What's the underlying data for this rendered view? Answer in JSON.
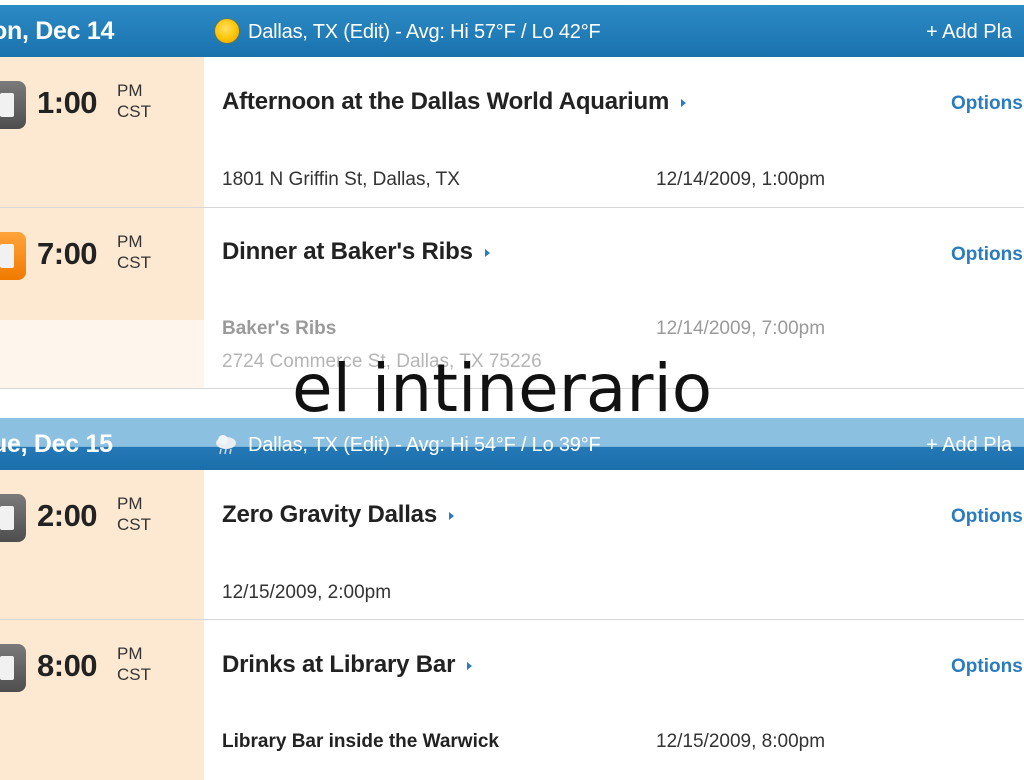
{
  "overlay": {
    "title": "el intinerario"
  },
  "days": [
    {
      "title": "on, Dec 14",
      "weather_icon": "sun-icon",
      "weather": "Dallas, TX (Edit) - Avg: Hi 57°F / Lo 42°F",
      "add_place": "+ Add Pla",
      "events": [
        {
          "time": "1:00",
          "ampm": "PM",
          "tz": "CST",
          "icon": "suitcase-icon",
          "icon_color": "#5e5e5e",
          "title": "Afternoon at the Dallas World Aquarium",
          "options": "Options",
          "address": "1801 N Griffin St, Dallas, TX",
          "datetime": "12/14/2009, 1:00pm"
        },
        {
          "time": "7:00",
          "ampm": "PM",
          "tz": "CST",
          "icon": "restaurant-icon",
          "icon_color": "#f58a10",
          "title": "Dinner at Baker's Ribs",
          "options": "Options",
          "venue": "Baker's Ribs",
          "address": "2724 Commerce St, Dallas, TX 75226",
          "datetime": "12/14/2009, 7:00pm"
        }
      ]
    },
    {
      "title": "ue, Dec 15",
      "weather_icon": "cloud-rain-icon",
      "weather": "Dallas, TX (Edit) - Avg: Hi 54°F / Lo 39°F",
      "add_place": "+ Add Pla",
      "events": [
        {
          "time": "2:00",
          "ampm": "PM",
          "tz": "CST",
          "icon": "suitcase-icon",
          "icon_color": "#5e5e5e",
          "title": "Zero Gravity Dallas",
          "options": "Options",
          "datetime": "12/15/2009, 2:00pm"
        },
        {
          "time": "8:00",
          "ampm": "PM",
          "tz": "CST",
          "icon": "suitcase-icon",
          "icon_color": "#5e5e5e",
          "title": "Drinks at Library Bar",
          "options": "Options",
          "venue": "Library Bar inside the Warwick",
          "datetime": "12/15/2009, 8:00pm"
        }
      ]
    }
  ]
}
